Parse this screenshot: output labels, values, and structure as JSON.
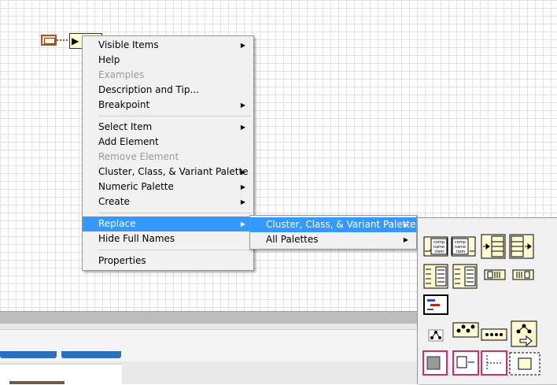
{
  "menu_main": {
    "items": [
      {
        "label": "Visible Items",
        "has_submenu": true,
        "enabled": true
      },
      {
        "label": "Help",
        "has_submenu": false,
        "enabled": true
      },
      {
        "label": "Examples",
        "has_submenu": false,
        "enabled": false
      },
      {
        "label": "Description and Tip...",
        "has_submenu": false,
        "enabled": true
      },
      {
        "label": "Breakpoint",
        "has_submenu": true,
        "enabled": true
      },
      {
        "label": "Select Item",
        "has_submenu": true,
        "enabled": true
      },
      {
        "label": "Add Element",
        "has_submenu": false,
        "enabled": true
      },
      {
        "label": "Remove Element",
        "has_submenu": false,
        "enabled": false
      },
      {
        "label": "Cluster, Class, & Variant Palette",
        "has_submenu": true,
        "enabled": true
      },
      {
        "label": "Numeric Palette",
        "has_submenu": true,
        "enabled": true
      },
      {
        "label": "Create",
        "has_submenu": true,
        "enabled": true
      },
      {
        "label": "Replace",
        "has_submenu": true,
        "enabled": true,
        "highlighted": true
      },
      {
        "label": "Hide Full Names",
        "has_submenu": false,
        "enabled": true
      },
      {
        "label": "Properties",
        "has_submenu": false,
        "enabled": true
      }
    ]
  },
  "menu_replace": {
    "items": [
      {
        "label": "Cluster, Class, & Variant Palette",
        "has_submenu": true,
        "highlighted": true
      },
      {
        "label": "All Palettes",
        "has_submenu": true
      }
    ]
  },
  "palette": {
    "icons": [
      {
        "name": "bundle-by-name-icon",
        "text": "comp name .item"
      },
      {
        "name": "unbundle-by-name-icon",
        "text": "comp name .item"
      },
      {
        "name": "bundle-icon"
      },
      {
        "name": "unbundle-icon"
      },
      {
        "name": "build-cluster-array-icon"
      },
      {
        "name": "index-bundle-cluster-array-icon"
      },
      {
        "name": "cluster-to-array-icon"
      },
      {
        "name": "array-to-cluster-icon"
      },
      {
        "name": "cluster-constant-icon"
      },
      {
        "name": "class-hierarchy-icon"
      },
      {
        "name": "variant-icon"
      },
      {
        "name": "dynamic-dispatch-icon"
      },
      {
        "name": "class-constant-icon"
      },
      {
        "name": "get-lv-class-icon"
      },
      {
        "name": "to-more-specific-icon"
      },
      {
        "name": "to-more-generic-icon"
      }
    ]
  },
  "colors": {
    "highlight": "#3399ff",
    "menu_bg": "#f1f1f1",
    "node_fill": "#fffbd2",
    "wire": "#a8552e",
    "panel_blue": "#2a6fc0"
  }
}
